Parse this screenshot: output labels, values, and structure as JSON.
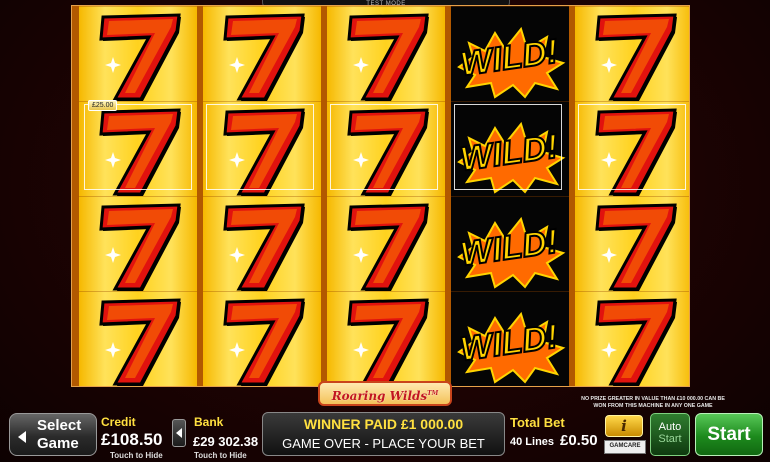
{
  "header": {
    "test_mode": "TEST MODE"
  },
  "reels": [
    [
      "seven",
      "seven",
      "seven",
      "seven"
    ],
    [
      "seven",
      "seven",
      "seven",
      "seven"
    ],
    [
      "seven",
      "seven",
      "seven",
      "seven"
    ],
    [
      "wild",
      "wild",
      "wild",
      "wild"
    ],
    [
      "seven",
      "seven",
      "seven",
      "seven"
    ]
  ],
  "symbols": {
    "wild_text": "WILD!",
    "seven_text": "7"
  },
  "win_line": {
    "amount": "£25.00"
  },
  "logo": {
    "text": "Roaring Wilds",
    "mark": "TM"
  },
  "notice": "NO PRIZE GREATER IN VALUE THAN £10 000.00 CAN BE WON FROM THIS MACHINE IN ANY ONE GAME",
  "controls": {
    "select_game_line1": "Select",
    "select_game_line2": "Game",
    "credit_label": "Credit",
    "credit_value": "£108.50",
    "credit_hint": "Touch to Hide",
    "bank_label": "Bank",
    "bank_value": "£29 302.38",
    "bank_hint": "Touch to Hide",
    "message_line1": "WINNER PAID £1 000.00",
    "message_line2": "GAME OVER - PLACE YOUR BET",
    "total_bet_label": "Total Bet",
    "lines_label": "40 Lines",
    "bet_value": "£0.50",
    "info_label": "i",
    "gamcare_label": "GAMCARE",
    "auto_line1": "Auto",
    "auto_line2": "Start",
    "start_label": "Start"
  },
  "colors": {
    "seven_red": "#e1120e",
    "seven_orange": "#ff7a00",
    "wild_yellow": "#ffd400",
    "label_yellow": "#ffe040",
    "start_green": "#1d8a1d"
  }
}
